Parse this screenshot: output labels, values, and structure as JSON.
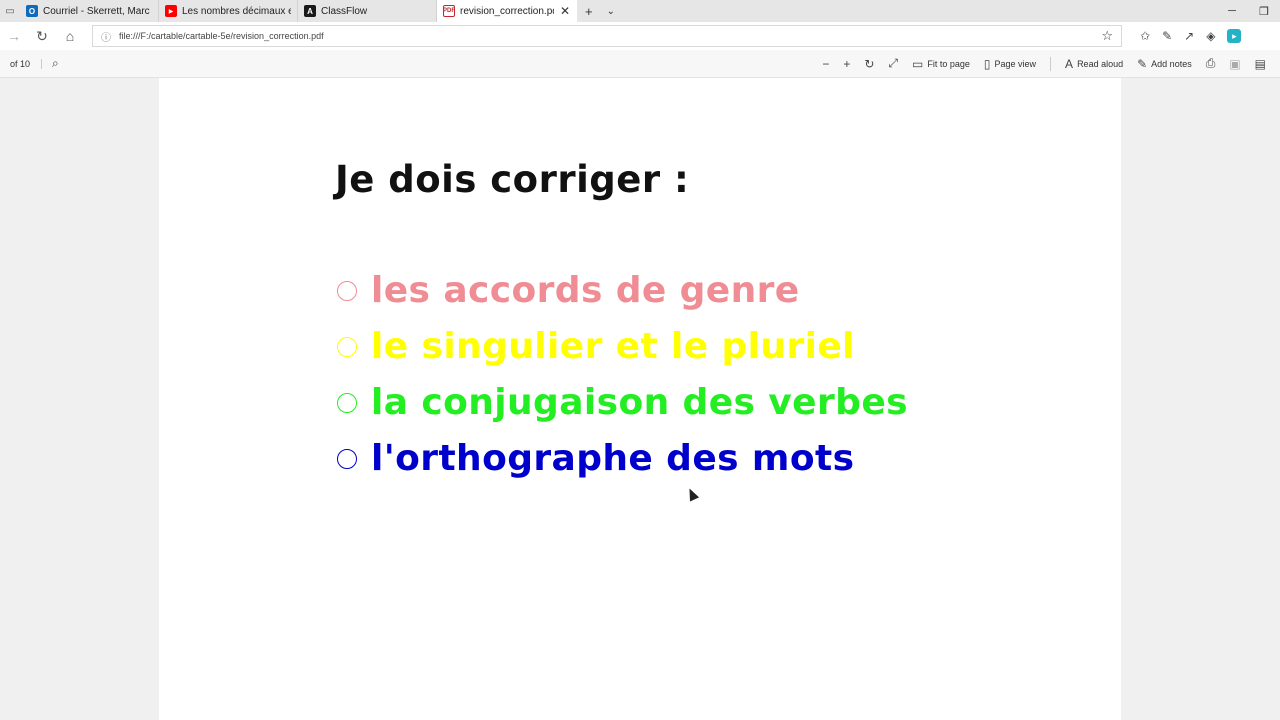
{
  "tabs": [
    {
      "label": "Courriel - Skerrett, Marc - C",
      "icon": "outlook-icon"
    },
    {
      "label": "Les nombres décimaux et la",
      "icon": "youtube-icon"
    },
    {
      "label": "ClassFlow",
      "icon": "classflow-icon"
    },
    {
      "label": "revision_correction.pdf",
      "icon": "pdf-icon",
      "active": true
    }
  ],
  "address": {
    "url": "file:///F:/cartable/cartable-5e/revision_correction.pdf"
  },
  "pdf_toolbar": {
    "page_count": "of 10",
    "fit_to_page": "Fit to page",
    "page_view": "Page view",
    "read_aloud": "Read aloud",
    "add_notes": "Add notes"
  },
  "document": {
    "heading": "Je dois corriger :",
    "items": [
      {
        "text": "les accords de genre",
        "color": "#f08c94"
      },
      {
        "text": "le singulier et le pluriel",
        "color": "#ffff00"
      },
      {
        "text": "la conjugaison des verbes",
        "color": "#22ee22"
      },
      {
        "text": "l'orthographe des mots",
        "color": "#0000cc"
      }
    ]
  }
}
